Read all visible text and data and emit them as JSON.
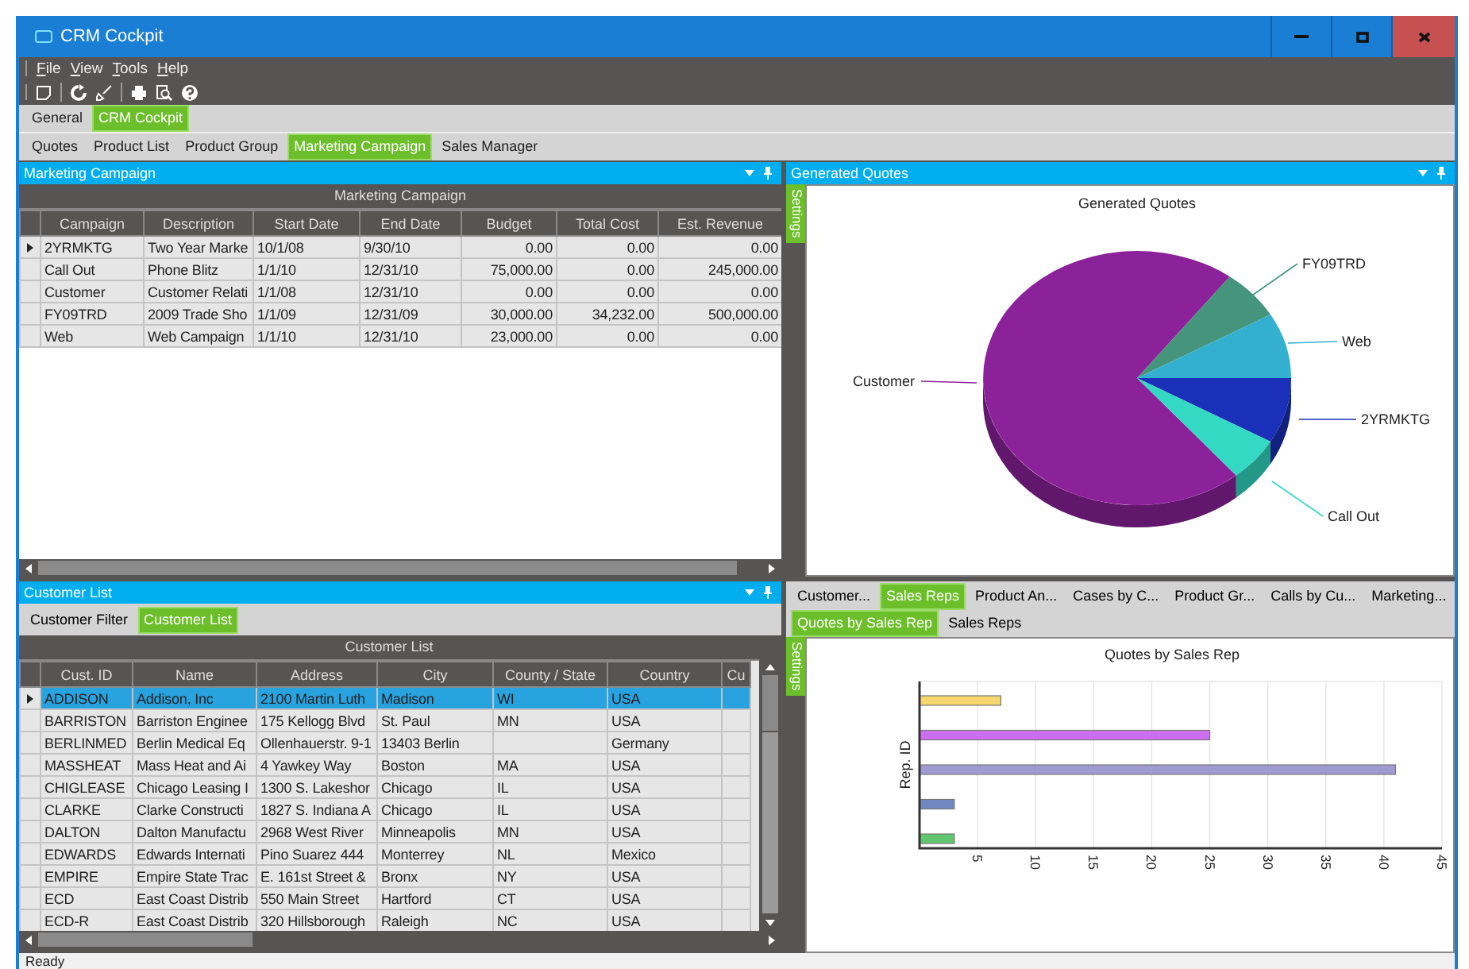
{
  "window": {
    "title": "CRM Cockpit"
  },
  "menu": [
    "File",
    "View",
    "Tools",
    "Help"
  ],
  "workspace_tabs": [
    {
      "label": "General",
      "selected": false
    },
    {
      "label": "CRM Cockpit",
      "selected": true
    }
  ],
  "view_tabs": [
    {
      "label": "Quotes",
      "selected": false
    },
    {
      "label": "Product List",
      "selected": false
    },
    {
      "label": "Product Group",
      "selected": false
    },
    {
      "label": "Marketing Campaign",
      "selected": true
    },
    {
      "label": "Sales Manager",
      "selected": false
    }
  ],
  "marketing_campaign": {
    "title": "Marketing Campaign",
    "grid_title": "Marketing Campaign",
    "columns": [
      "Campaign",
      "Description",
      "Start Date",
      "End Date",
      "Budget",
      "Total Cost",
      "Est. Revenue"
    ],
    "rows": [
      {
        "selected": true,
        "campaign": "2YRMKTG",
        "description": "Two Year Marke",
        "start": "10/1/08",
        "end": "9/30/10",
        "budget": "0.00",
        "total_cost": "0.00",
        "revenue": "0.00"
      },
      {
        "selected": false,
        "campaign": "Call Out",
        "description": "Phone Blitz",
        "start": "1/1/10",
        "end": "12/31/10",
        "budget": "75,000.00",
        "total_cost": "0.00",
        "revenue": "245,000.00"
      },
      {
        "selected": false,
        "campaign": "Customer",
        "description": "Customer Relati",
        "start": "1/1/08",
        "end": "12/31/10",
        "budget": "0.00",
        "total_cost": "0.00",
        "revenue": "0.00"
      },
      {
        "selected": false,
        "campaign": "FY09TRD",
        "description": "2009 Trade Sho",
        "start": "1/1/09",
        "end": "12/31/09",
        "budget": "30,000.00",
        "total_cost": "34,232.00",
        "revenue": "500,000.00"
      },
      {
        "selected": false,
        "campaign": "Web",
        "description": "Web Campaign",
        "start": "1/1/10",
        "end": "12/31/10",
        "budget": "23,000.00",
        "total_cost": "0.00",
        "revenue": "0.00"
      }
    ]
  },
  "generated_quotes": {
    "title": "Generated Quotes",
    "settings_tab": "Settings",
    "chart_title": "Generated Quotes",
    "slices": [
      {
        "label": "Customer",
        "color": "#8c229a"
      },
      {
        "label": "FY09TRD",
        "color": "#45957c"
      },
      {
        "label": "Web",
        "color": "#33b0d0"
      },
      {
        "label": "2YRMKTG",
        "color": "#1a30b8"
      },
      {
        "label": "Call Out",
        "color": "#33d9c3"
      }
    ]
  },
  "customer_list": {
    "title": "Customer List",
    "tabs": [
      {
        "label": "Customer Filter",
        "selected": false
      },
      {
        "label": "Customer List",
        "selected": true
      }
    ],
    "grid_title": "Customer List",
    "columns": [
      "Cust. ID",
      "Name",
      "Address",
      "City",
      "County / State",
      "Country",
      "Cu"
    ],
    "rows": [
      {
        "selected": true,
        "id": "ADDISON",
        "name": "Addison, Inc",
        "address": "2100 Martin Luth",
        "city": "Madison",
        "state": "WI",
        "country": "USA"
      },
      {
        "selected": false,
        "id": "BARRISTON",
        "name": "Barriston Enginee",
        "address": "175 Kellogg Blvd",
        "city": "St. Paul",
        "state": "MN",
        "country": "USA"
      },
      {
        "selected": false,
        "id": "BERLINMED",
        "name": "Berlin Medical Eq",
        "address": "Ollenhauerstr. 9-1",
        "city": "13403 Berlin",
        "country": "Germany"
      },
      {
        "selected": false,
        "id": "MASSHEAT",
        "name": "Mass Heat and Ai",
        "address": "4 Yawkey Way",
        "city": "Boston",
        "state": "MA",
        "country": "USA"
      },
      {
        "selected": false,
        "id": "CHIGLEASE",
        "name": "Chicago Leasing I",
        "address": "1300 S. Lakeshor",
        "city": "Chicago",
        "state": "IL",
        "country": "USA"
      },
      {
        "selected": false,
        "id": "CLARKE",
        "name": "Clarke Constructi",
        "address": "1827 S. Indiana A",
        "city": "Chicago",
        "state": "IL",
        "country": "USA"
      },
      {
        "selected": false,
        "id": "DALTON",
        "name": "Dalton Manufactu",
        "address": "2968 West River",
        "city": "Minneapolis",
        "state": "MN",
        "country": "USA"
      },
      {
        "selected": false,
        "id": "EDWARDS",
        "name": "Edwards Internati",
        "address": "Pino Suarez 444",
        "city": "Monterrey",
        "state": "NL",
        "country": "Mexico"
      },
      {
        "selected": false,
        "id": "EMPIRE",
        "name": "Empire State Trac",
        "address": "E. 161st Street &",
        "city": "Bronx",
        "state": "NY",
        "country": "USA"
      },
      {
        "selected": false,
        "id": "ECD",
        "name": "East Coast Distrib",
        "address": "550 Main Street",
        "city": "Hartford",
        "state": "CT",
        "country": "USA"
      },
      {
        "selected": false,
        "id": "ECD-R",
        "name": "East Coast Distrib",
        "address": "320 Hillsborough",
        "city": "Raleigh",
        "state": "NC",
        "country": "USA"
      }
    ]
  },
  "analysis": {
    "tabs": [
      {
        "label": "Customer...",
        "selected": false
      },
      {
        "label": "Sales Reps",
        "selected": true
      },
      {
        "label": "Product An...",
        "selected": false
      },
      {
        "label": "Cases by C...",
        "selected": false
      },
      {
        "label": "Product Gr...",
        "selected": false
      },
      {
        "label": "Calls by Cu...",
        "selected": false
      },
      {
        "label": "Marketing...",
        "selected": false
      }
    ],
    "subtabs": [
      {
        "label": "Quotes by Sales Rep",
        "selected": true
      },
      {
        "label": "Sales Reps",
        "selected": false
      }
    ],
    "settings_tab": "Settings",
    "chart_data": {
      "type": "bar",
      "orientation": "horizontal",
      "title": "Quotes by Sales Rep",
      "ylabel": "Rep. ID",
      "values": [
        7,
        25,
        41,
        3,
        3
      ],
      "grid": true,
      "xlim": [
        0,
        45
      ],
      "xticks": [
        5,
        10,
        15,
        20,
        25,
        30,
        35,
        40,
        45
      ]
    }
  },
  "status_bar": "Ready"
}
